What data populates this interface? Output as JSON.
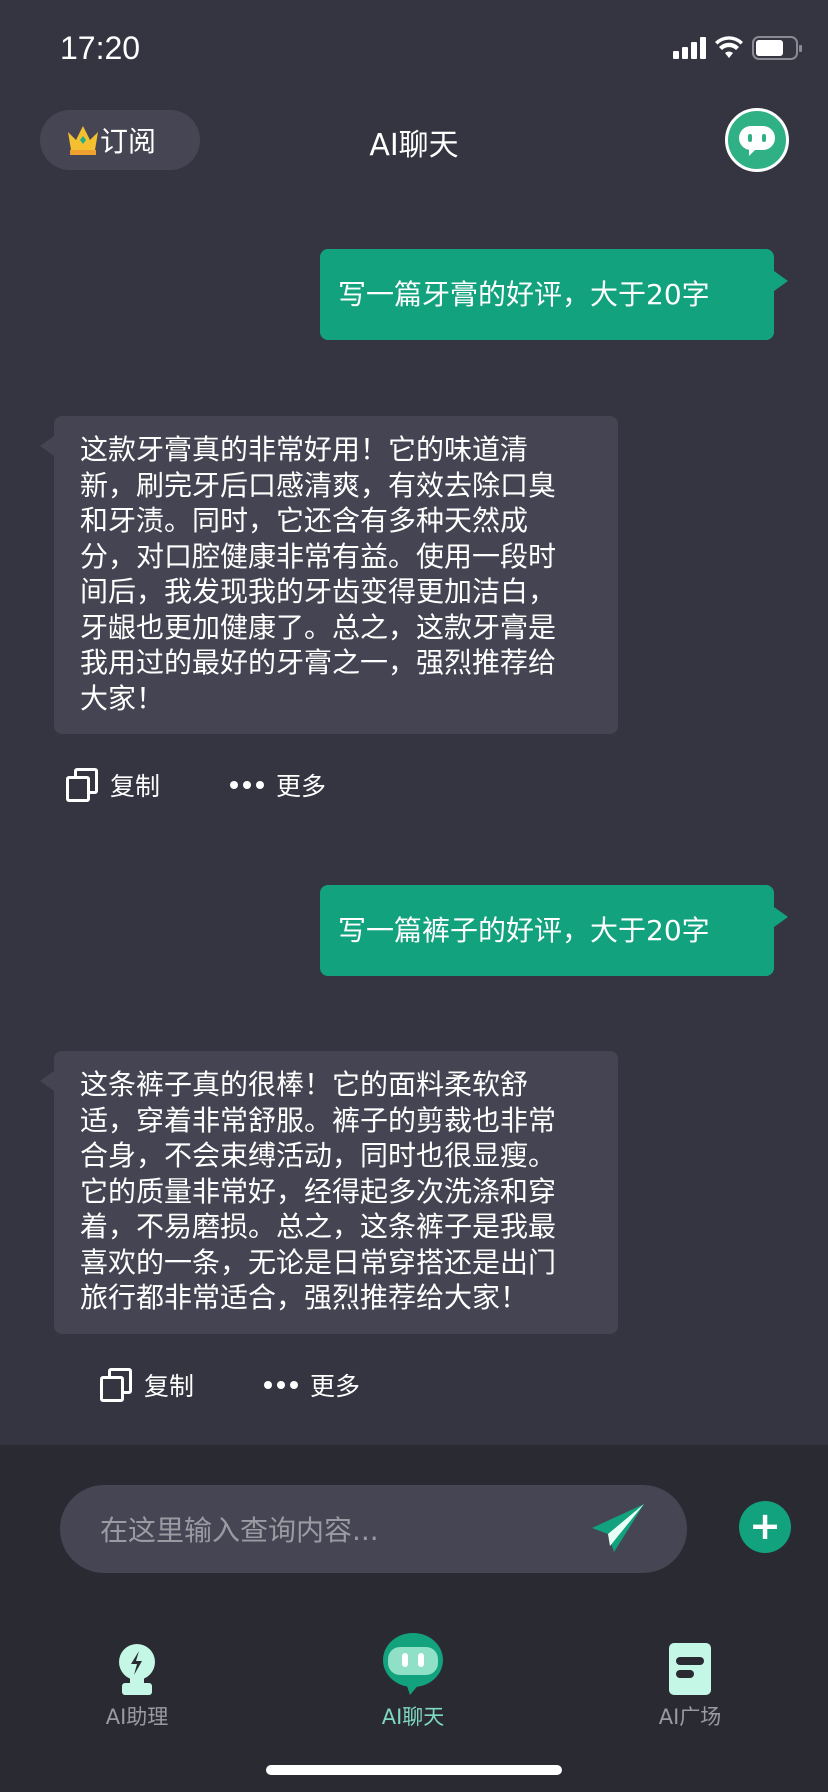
{
  "status": {
    "time": "17:20"
  },
  "header": {
    "subscribe_label": "订阅",
    "title": "AI聊天"
  },
  "messages": [
    {
      "role": "user",
      "text": "写一篇牙膏的好评，大于20字"
    },
    {
      "role": "assistant",
      "lines": [
        "这款牙膏真的非常好用！它的味道清",
        "新，刷完牙后口感清爽，有效去除口臭",
        "和牙渍。同时，它还含有多种天然成",
        "分，对口腔健康非常有益。使用一段时",
        "间后，我发现我的牙齿变得更加洁白，",
        "牙龈也更加健康了。总之，这款牙膏是",
        "我用过的最好的牙膏之一，强烈推荐给",
        "大家！"
      ]
    },
    {
      "role": "user",
      "text": "写一篇裤子的好评，大于20字"
    },
    {
      "role": "assistant",
      "lines": [
        "这条裤子真的很棒！它的面料柔软舒",
        "适，穿着非常舒服。裤子的剪裁也非常",
        "合身，不会束缚活动，同时也很显瘦。",
        "它的质量非常好，经得起多次洗涤和穿",
        "着，不易磨损。总之，这条裤子是我最",
        "喜欢的一条，无论是日常穿搭还是出门",
        "旅行都非常适合，强烈推荐给大家！"
      ]
    }
  ],
  "actions": {
    "copy": "复制",
    "more": "更多"
  },
  "input": {
    "placeholder": "在这里输入查询内容..."
  },
  "tabs": [
    {
      "label": "AI助理"
    },
    {
      "label": "AI聊天",
      "active": true
    },
    {
      "label": "AI广场"
    }
  ],
  "colors": {
    "accent": "#12a27e",
    "background": "#353541",
    "bubble": "#444452"
  }
}
